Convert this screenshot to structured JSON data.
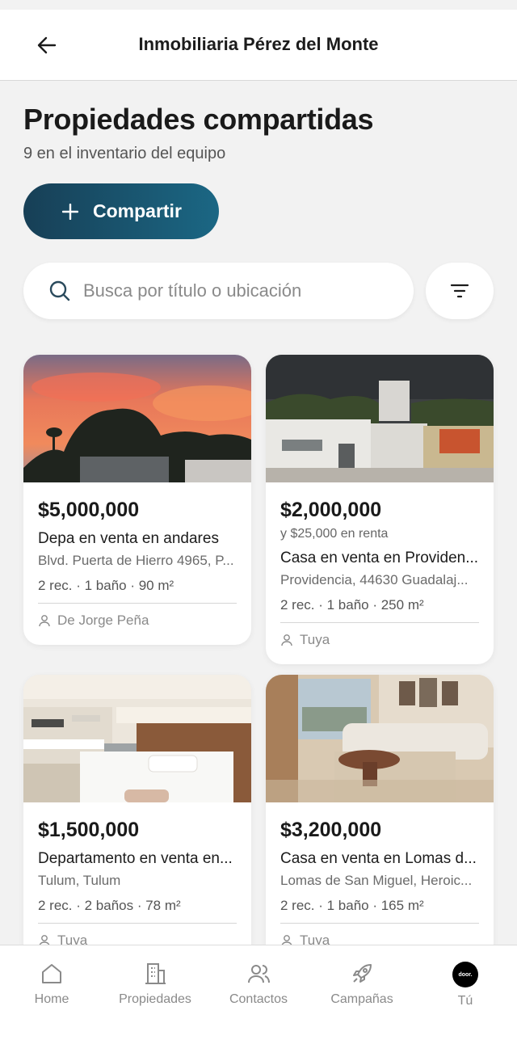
{
  "header": {
    "title": "Inmobiliaria Pérez del Monte"
  },
  "page": {
    "title": "Propiedades compartidas",
    "subtitle": "9 en el inventario del equipo"
  },
  "actions": {
    "share_label": "Compartir"
  },
  "search": {
    "placeholder": "Busca por título o ubicación",
    "value": ""
  },
  "listings": [
    {
      "price": "$5,000,000",
      "rent": "",
      "title": "Depa en venta en andares",
      "address": "Blvd. Puerta de Hierro 4965, P...",
      "specs": "2 rec. · 1 baño · 90 m²",
      "owner": "De Jorge Peña"
    },
    {
      "price": "$2,000,000",
      "rent": "y $25,000 en renta",
      "title": "Casa en venta en Providen...",
      "address": "Providencia, 44630 Guadalaj...",
      "specs": "2 rec. · 1 baño · 250 m²",
      "owner": "Tuya"
    },
    {
      "price": "$1,500,000",
      "rent": "",
      "title": "Departamento en venta en...",
      "address": "Tulum, Tulum",
      "specs": "2 rec. · 2 baños · 78 m²",
      "owner": "Tuya"
    },
    {
      "price": "$3,200,000",
      "rent": "",
      "title": "Casa en venta en Lomas d...",
      "address": "Lomas de San Miguel, Heroic...",
      "specs": "2 rec. · 1 baño · 165 m²",
      "owner": "Tuya"
    }
  ],
  "nav": {
    "items": [
      {
        "label": "Home",
        "icon": "home-icon"
      },
      {
        "label": "Propiedades",
        "icon": "building-icon"
      },
      {
        "label": "Contactos",
        "icon": "contacts-icon"
      },
      {
        "label": "Campañas",
        "icon": "rocket-icon"
      },
      {
        "label": "Tú",
        "icon": "avatar"
      }
    ],
    "avatar_text": "door."
  },
  "colors": {
    "accent_start": "#173f56",
    "accent_end": "#1b6784",
    "background": "#f2f2f2"
  }
}
